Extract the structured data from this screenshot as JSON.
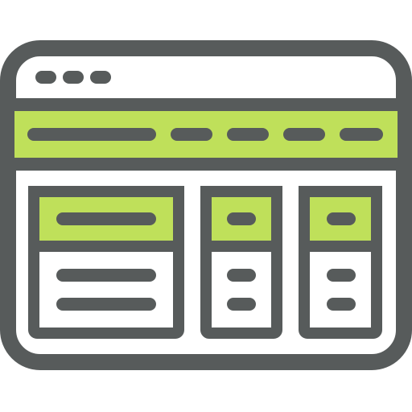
{
  "icon": {
    "name": "browser-window-layout-icon",
    "colors": {
      "outline": "#575b5b",
      "accent": "#bfe05a",
      "fill": "#ffffff"
    }
  }
}
